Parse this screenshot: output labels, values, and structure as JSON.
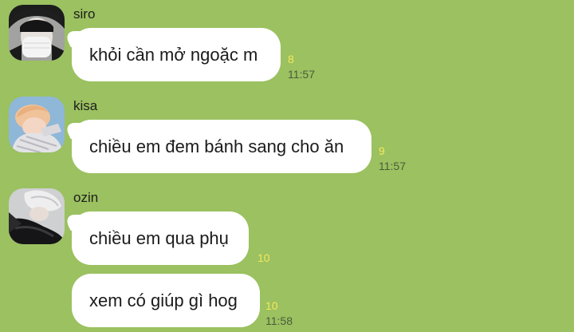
{
  "colors": {
    "background": "#9bc160",
    "bubble": "#ffffff",
    "unread_count": "#f3e85a",
    "timestamp": "#4c5b3c"
  },
  "messages": [
    {
      "sender": "siro",
      "avatar_icon": "user-avatar-masked-person-icon",
      "bubbles": [
        {
          "text": "khỏi cần mở ngoặc m",
          "unread": "8",
          "time": "11:57"
        }
      ]
    },
    {
      "sender": "kisa",
      "avatar_icon": "user-avatar-blond-person-icon",
      "bubbles": [
        {
          "text": "chiều em đem bánh sang cho ăn",
          "unread": "9",
          "time": "11:57"
        }
      ]
    },
    {
      "sender": "ozin",
      "avatar_icon": "user-avatar-silver-hair-person-icon",
      "bubbles": [
        {
          "text": "chiều em qua phụ",
          "unread": "10"
        },
        {
          "text": "xem có giúp gì hog",
          "unread": "10",
          "time": "11:58"
        }
      ]
    }
  ]
}
